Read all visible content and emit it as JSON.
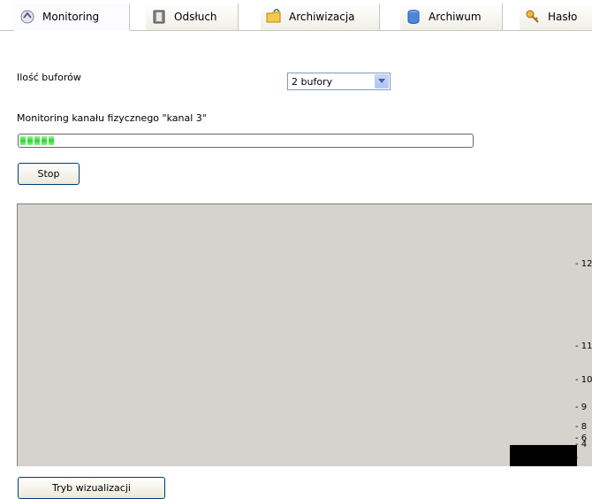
{
  "tabs": [
    {
      "label": "Monitoring",
      "icon": "monitoring-icon",
      "active": true
    },
    {
      "label": "Odsłuch",
      "icon": "speaker-icon",
      "active": false
    },
    {
      "label": "Archiwizacja",
      "icon": "archive-folder-icon",
      "active": false
    },
    {
      "label": "Archiwum",
      "icon": "database-icon",
      "active": false
    },
    {
      "label": "Hasło",
      "icon": "key-icon",
      "active": false
    }
  ],
  "buffers": {
    "label": "Ilość buforów",
    "selected": "2 bufory"
  },
  "monitoring": {
    "label": "Monitoring kanału fizycznego \"kanal 3\"",
    "progress_segments": 5,
    "stop_label": "Stop"
  },
  "visualization": {
    "background_color": "#d6d3ce",
    "ticks": [
      "- 12",
      "- 11",
      "- 10",
      "-  9",
      "-  8",
      "-  6",
      "-  4",
      "-"
    ]
  },
  "footer": {
    "mode_button_label": "Tryb wizualizacji"
  }
}
